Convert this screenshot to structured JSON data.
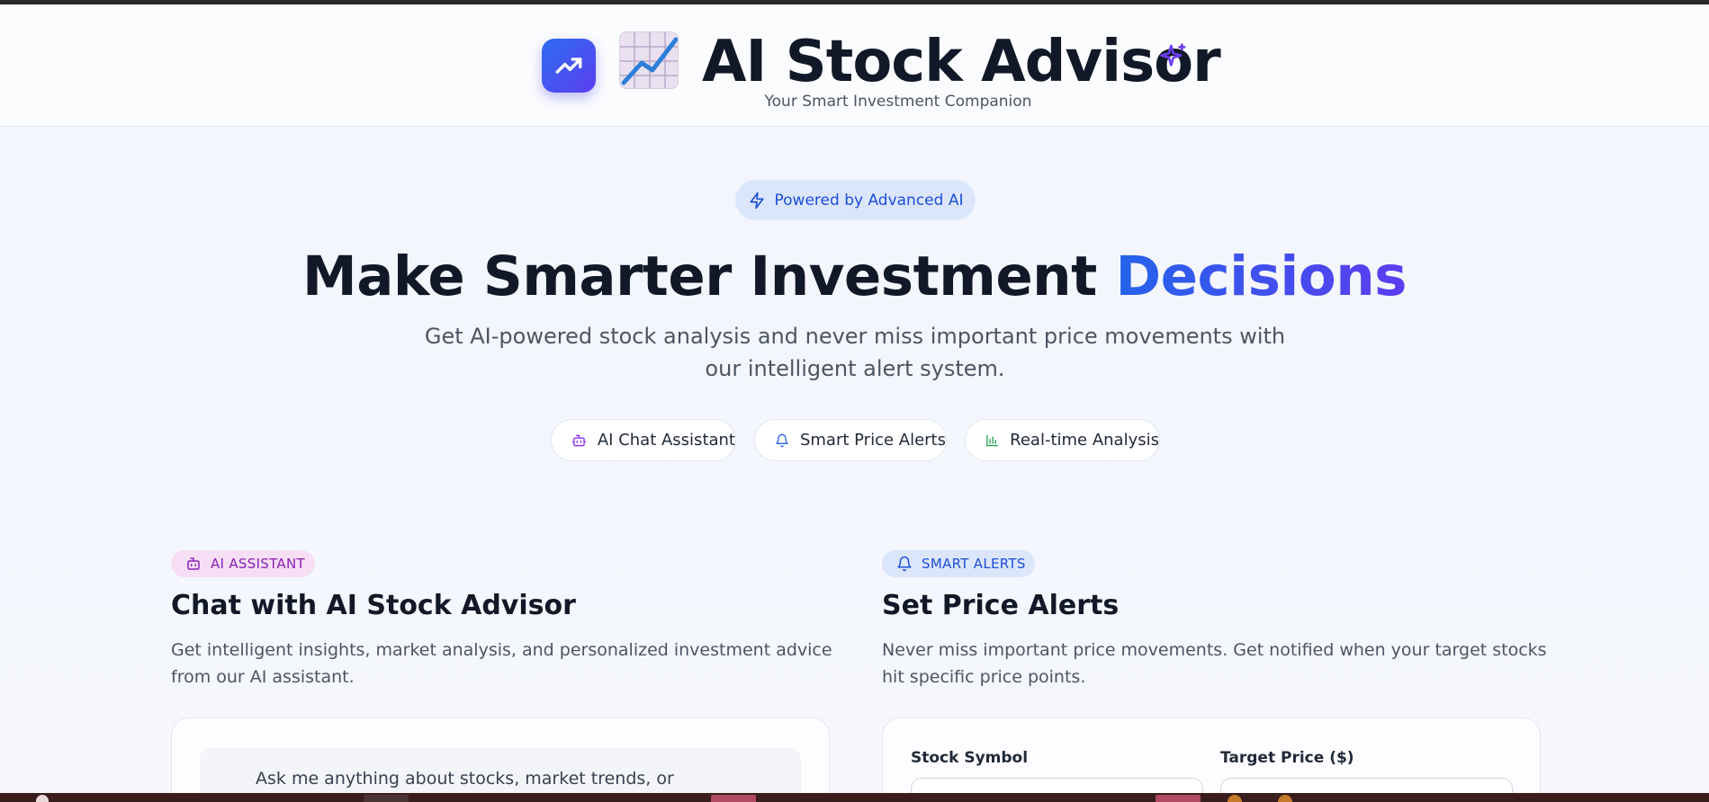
{
  "header": {
    "app_title": "AI Stock Advisor",
    "app_subtitle": "Your Smart Investment Companion",
    "logo_icon": "trending-up-icon",
    "emoji_icon": "chart-increasing-emoji",
    "sparkle_icon": "sparkles-icon"
  },
  "hero": {
    "badge": "Powered by Advanced AI",
    "badge_icon": "zap-icon",
    "title_main": "Make Smarter Investment ",
    "title_accent": "Decisions",
    "description": "Get AI-powered stock analysis and never miss important price movements with our intelligent alert system.",
    "features": [
      {
        "label": "AI Chat Assistant",
        "icon": "bot-icon",
        "color": "#9333ea"
      },
      {
        "label": "Smart Price Alerts",
        "icon": "bell-icon",
        "color": "#2563eb"
      },
      {
        "label": "Real-time Analysis",
        "icon": "bar-chart-icon",
        "color": "#16a34a"
      }
    ]
  },
  "ai_section": {
    "tag": "AI ASSISTANT",
    "title": "Chat with AI Stock Advisor",
    "description": "Get intelligent insights, market analysis, and personalized investment advice from our AI assistant.",
    "chat_greeting": "Ask me anything about stocks, market trends, or investment"
  },
  "alerts_section": {
    "tag": "SMART ALERTS",
    "title": "Set Price Alerts",
    "description": "Never miss important price movements. Get notified when your target stocks hit specific price points.",
    "symbol_label": "Stock Symbol",
    "price_label": "Target Price ($)"
  },
  "colors": {
    "brand_gradient_start": "#2f6df2",
    "brand_gradient_end": "#5b3df0",
    "ai_tag_bg": "#f6dff4",
    "alerts_tag_bg": "#dbe6fb"
  }
}
